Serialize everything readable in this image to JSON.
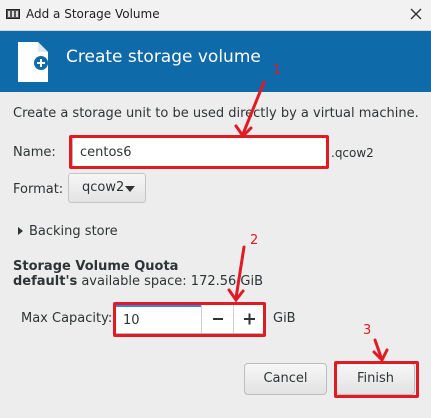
{
  "window": {
    "title": "Add a Storage Volume"
  },
  "header": {
    "title": "Create storage volume"
  },
  "form": {
    "description": "Create a storage unit to be used directly by a virtual machine.",
    "name_label": "Name:",
    "name_value": "centos6",
    "name_suffix": ".qcow2",
    "format_label": "Format:",
    "format_value": "qcow2",
    "backing_store_label": "Backing store",
    "quota_title": "Storage Volume Quota",
    "quota_pool": "default's",
    "quota_available": " available space: 172.56 GiB",
    "max_capacity_label": "Max Capacity:",
    "max_capacity_value": "10",
    "max_capacity_unit": "GiB"
  },
  "buttons": {
    "cancel": "Cancel",
    "finish": "Finish"
  },
  "annotations": {
    "marker_1": "1",
    "marker_2": "2",
    "marker_3": "3",
    "color": "#e01b24"
  },
  "colors": {
    "header_bg": "#0e6aa8",
    "focus_accent": "#3584e4"
  }
}
